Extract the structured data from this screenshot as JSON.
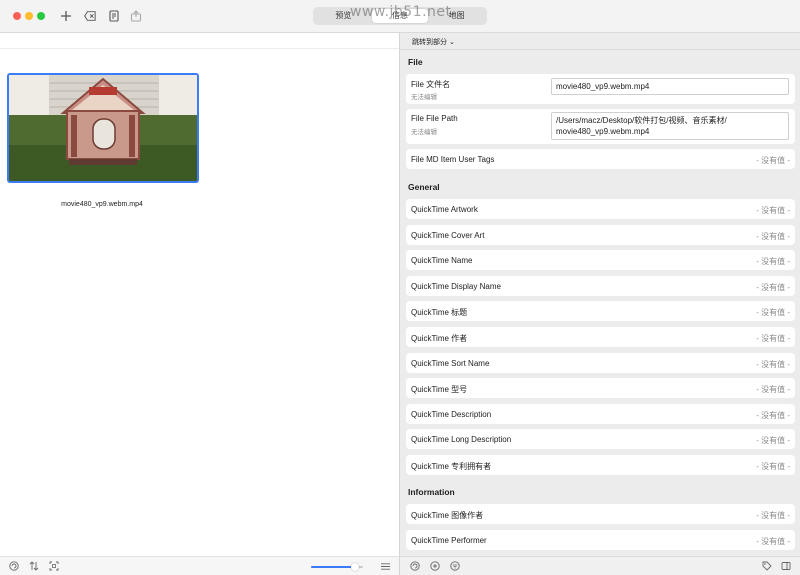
{
  "toolbar": {
    "segments": [
      "预览",
      "信息",
      "地图"
    ],
    "watermark": "www.jb51.net"
  },
  "left": {
    "thumbnail_name": "movie480_vp9.webm.mp4",
    "zoom_level": 0.85
  },
  "right": {
    "jump_label": "跳转到部分 ⌄",
    "sections": {
      "file": "File",
      "general": "General",
      "information": "Information"
    },
    "file_rows": {
      "name_label": "File 文件名",
      "name_sub": "无法编辑",
      "name_value": "movie480_vp9.webm.mp4",
      "path_label": "File File Path",
      "path_sub": "无法编辑",
      "path_value_line1": "/Users/macz/Desktop/软件打包/视频、音乐素材/",
      "path_value_line2": "movie480_vp9.webm.mp4",
      "tags_label": "File MD Item User Tags",
      "tags_value": "- 没有值 -"
    },
    "general_rows": [
      {
        "label": "QuickTime Artwork",
        "value": "- 没有值 -"
      },
      {
        "label": "QuickTime Cover Art",
        "value": "- 没有值 -"
      },
      {
        "label": "QuickTime Name",
        "value": "- 没有值 -"
      },
      {
        "label": "QuickTime Display Name",
        "value": "- 没有值 -"
      },
      {
        "label": "QuickTime 标题",
        "value": "- 没有值 -"
      },
      {
        "label": "QuickTime 作者",
        "value": "- 没有值 -"
      },
      {
        "label": "QuickTime Sort Name",
        "value": "- 没有值 -"
      },
      {
        "label": "QuickTime 型号",
        "value": "- 没有值 -"
      },
      {
        "label": "QuickTime Description",
        "value": "- 没有值 -"
      },
      {
        "label": "QuickTime Long Description",
        "value": "- 没有值 -"
      },
      {
        "label": "QuickTime 专利拥有者",
        "value": "- 没有值 -"
      }
    ],
    "information_rows": [
      {
        "label": "QuickTime 图像作者",
        "value": "- 没有值 -"
      },
      {
        "label": "QuickTime Performer",
        "value": "- 没有值 -"
      }
    ]
  },
  "colors": {
    "accent": "#3b7cf6",
    "close": "#fe5f57",
    "minimize": "#febc2e",
    "zoom": "#28c840"
  }
}
